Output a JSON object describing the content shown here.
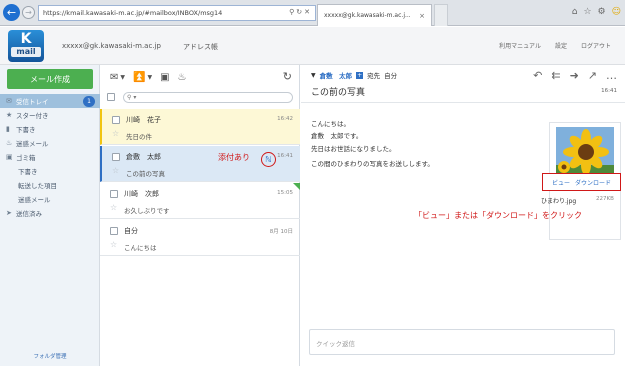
{
  "browser": {
    "url": "https://kmail.kawasaki-m.ac.jp/#mailbox/INBOX/msg14",
    "tab_title": "xxxxx@gk.kawasaki-m.ac.j..."
  },
  "header": {
    "logo_letter": "K",
    "logo_text": "mail",
    "account": "xxxxx@gk.kawasaki-m.ac.jp",
    "address_book": "アドレス帳",
    "links": [
      "利用マニュアル",
      "設定",
      "ログアウト"
    ]
  },
  "sidebar": {
    "compose": "メール作成",
    "folders": [
      {
        "label": "受信トレイ",
        "badge": "1",
        "icon": "inbox-icon"
      },
      {
        "label": "スター付き",
        "icon": "star-icon"
      },
      {
        "label": "下書き",
        "icon": "draft-icon"
      },
      {
        "label": "迷惑メール",
        "icon": "flame-icon"
      },
      {
        "label": "ゴミ箱",
        "icon": "trash-icon"
      },
      {
        "label": "下書き",
        "icon": ""
      },
      {
        "label": "転送した項目",
        "icon": ""
      },
      {
        "label": "迷惑メール",
        "icon": ""
      },
      {
        "label": "送信済み",
        "icon": "send-icon"
      }
    ],
    "folder_management": "フォルダ管理"
  },
  "list": {
    "items": [
      {
        "from": "川崎　花子",
        "subject": "先日の件",
        "date": "16:42",
        "state": "unread"
      },
      {
        "from": "倉敷　太郎",
        "subject": "この前の写真",
        "date": "16:41",
        "state": "selected",
        "attachment": true
      },
      {
        "from": "川崎　次郎",
        "subject": "お久しぶりです",
        "date": "15:05",
        "state": "normal",
        "flag": true
      },
      {
        "from": "自分",
        "subject": "こんにちは",
        "date": "8月 10日",
        "state": "normal"
      }
    ]
  },
  "annotations": {
    "attachment": "添付あり",
    "click_hint": "「ビュー」または「ダウンロード」をクリック"
  },
  "reader": {
    "sender": "倉敷　太郎",
    "to_label": "宛先",
    "recipient": "自分",
    "subject": "この前の写真",
    "time": "16:41",
    "body": [
      "こんにちは。",
      "倉敷　太郎です。",
      "先日はお世話になりました。",
      "この間のひまわりの写真をお送しします。"
    ],
    "attachment": {
      "view": "ビュー",
      "download": "ダウンロード",
      "filename": "ひまわり.jpg",
      "size": "227KB"
    },
    "quick_reply_placeholder": "クイック返信"
  },
  "colors": {
    "accent_blue": "#2e6fc4",
    "compose_green": "#4caf50",
    "annotation_red": "#d01818",
    "unread_yellow": "#fdf8d6"
  }
}
